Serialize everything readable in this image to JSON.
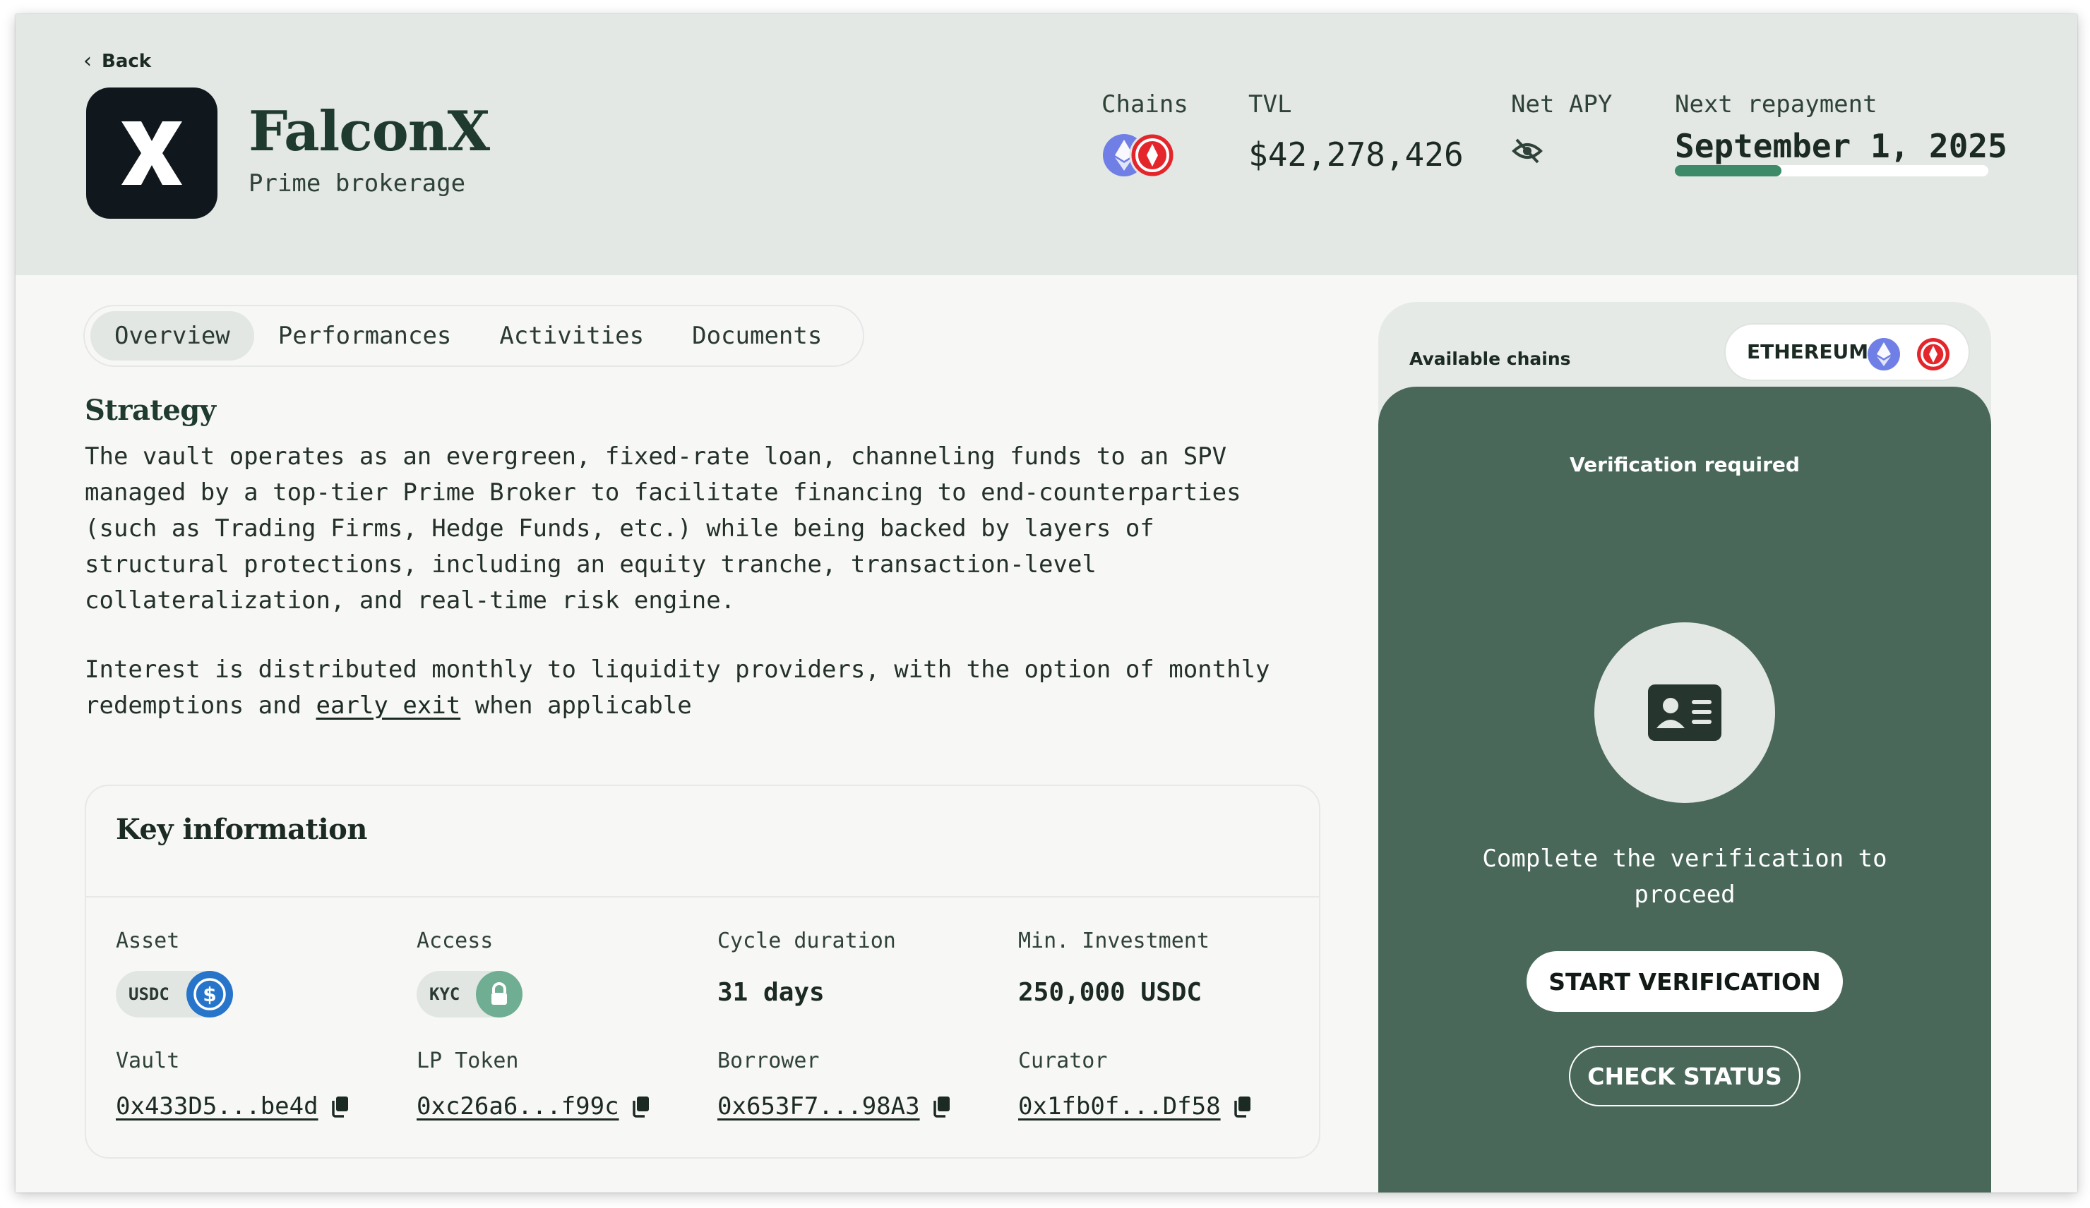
{
  "header": {
    "back_label": "Back",
    "title": "FalconX",
    "subtitle": "Prime brokerage",
    "stats": {
      "chains_label": "Chains",
      "tvl_label": "TVL",
      "tvl_value": "$42,278,426",
      "apy_label": "Net APY",
      "repayment_label": "Next repayment",
      "repayment_value": "September 1, 2025",
      "repayment_progress_fraction": 0.34
    }
  },
  "tabs": [
    "Overview",
    "Performances",
    "Activities",
    "Documents"
  ],
  "strategy": {
    "title": "Strategy",
    "paragraph1": "The vault operates as an evergreen, fixed-rate loan, channeling funds to an SPV\nmanaged by a top-tier Prime Broker to facilitate financing to end-counterparties\n(such as Trading Firms, Hedge Funds, etc.) while being backed by layers of\nstructural protections, including an equity tranche, transaction-level\ncollateralization, and real-time risk engine.",
    "paragraph2_before": "Interest is distributed monthly to liquidity providers, with the option of monthly\nredemptions and ",
    "paragraph2_link": "early exit",
    "paragraph2_after": " when applicable"
  },
  "key_info": {
    "title": "Key information",
    "asset_label": "Asset",
    "asset_value": "USDC",
    "access_label": "Access",
    "access_value": "KYC",
    "cycle_label": "Cycle duration",
    "cycle_value": "31 days",
    "min_label": "Min. Investment",
    "min_value": "250,000 USDC",
    "vault_label": "Vault",
    "vault_value": "0x433D5...be4d",
    "lp_label": "LP Token",
    "lp_value": "0xc26a6...f99c",
    "borrower_label": "Borrower",
    "borrower_value": "0x653F7...98A3",
    "curator_label": "Curator",
    "curator_value": "0x1fb0f...Df58"
  },
  "panel": {
    "available_label": "Available chains",
    "chain_name": "ETHEREUM",
    "verification_title": "Verification required",
    "verification_text": "Complete the verification to proceed",
    "start_button": "START VERIFICATION",
    "check_button": "CHECK STATUS"
  },
  "colors": {
    "header_bg": "#e3e8e4",
    "panel_green": "#49685a",
    "progress_fill": "#3d8a68",
    "eth_blue": "#6f7fe6",
    "chain_red": "#e4262c",
    "usdc_blue": "#2775ca",
    "kyc_green": "#6fae93"
  },
  "icons": [
    "chevron-left-icon",
    "falconx-logo",
    "ethereum-icon",
    "red-chain-icon",
    "eye-slash-icon",
    "usdc-icon",
    "lock-icon",
    "copy-icon",
    "id-card-icon"
  ]
}
